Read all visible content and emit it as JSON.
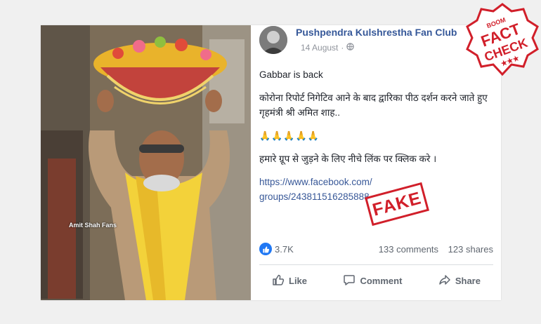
{
  "post": {
    "page_name": "Pushpendra Kulshrestha Fan Club",
    "date": "14 August",
    "date_separator": "·",
    "line1": "Gabbar is back",
    "line2": "कोरोना रिपोर्ट निगेटिव आने के बाद द्वारिका पीठ दर्शन करने जाते हुए गृहमंत्री श्री अमित शाह..",
    "line3": "🙏🙏🙏🙏🙏",
    "line4": "हमारे ग्रूप से जुड़ने के लिए नीचे लिंक पर क्लिक करे ।",
    "link_line1": "https://www.facebook.com/",
    "link_line2": "groups/243811516285888"
  },
  "photo": {
    "watermark": "Amit Shah Fans"
  },
  "stamp": {
    "fake_label": "FAKE"
  },
  "badge": {
    "top_text": "BOOM",
    "line1": "FACT",
    "line2": "CHECK",
    "stars": "★★★"
  },
  "reactions": {
    "like_count": "3.7K",
    "comments": "133 comments",
    "shares": "123 shares"
  },
  "actions": {
    "like": "Like",
    "comment": "Comment",
    "share": "Share"
  },
  "colors": {
    "link": "#385898",
    "page_name": "#365899",
    "stamp_red": "#d11f2a",
    "like_blue": "#2078f4"
  }
}
